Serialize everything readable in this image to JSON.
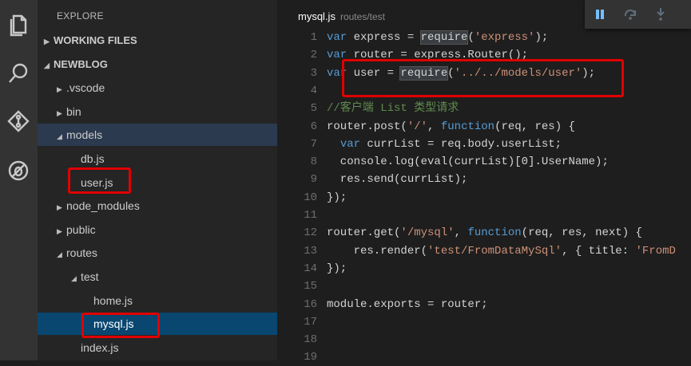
{
  "sidebar": {
    "title": "EXPLORE",
    "items": [
      {
        "label": "WORKING FILES",
        "tw": "▶",
        "indent": 8,
        "section": true
      },
      {
        "label": "NEWBLOG",
        "tw": "◢",
        "indent": 8,
        "section": true
      },
      {
        "label": ".vscode",
        "tw": "▶",
        "indent": 24
      },
      {
        "label": "bin",
        "tw": "▶",
        "indent": 24
      },
      {
        "label": "models",
        "tw": "◢",
        "indent": 24,
        "hl": true
      },
      {
        "label": "db.js",
        "tw": "",
        "indent": 42
      },
      {
        "label": "user.js",
        "tw": "",
        "indent": 42
      },
      {
        "label": "node_modules",
        "tw": "▶",
        "indent": 24
      },
      {
        "label": "public",
        "tw": "▶",
        "indent": 24
      },
      {
        "label": "routes",
        "tw": "◢",
        "indent": 24
      },
      {
        "label": "test",
        "tw": "◢",
        "indent": 42
      },
      {
        "label": "home.js",
        "tw": "",
        "indent": 58
      },
      {
        "label": "mysql.js",
        "tw": "",
        "indent": 58,
        "sel": true
      },
      {
        "label": "index.js",
        "tw": "",
        "indent": 42
      }
    ]
  },
  "editor": {
    "filename": "mysql.js",
    "path": "routes/test",
    "lines": [
      [
        [
          "kw",
          "var "
        ],
        [
          "id",
          "express = "
        ],
        [
          "id",
          "require",
          "hl"
        ],
        [
          "id",
          "("
        ],
        [
          "str",
          "'express'"
        ],
        [
          "id",
          ");"
        ]
      ],
      [
        [
          "kw",
          "var "
        ],
        [
          "id",
          "router = express.Router();"
        ]
      ],
      [
        [
          "kw",
          "var "
        ],
        [
          "id",
          "user = "
        ],
        [
          "id",
          "require",
          "hl"
        ],
        [
          "id",
          "("
        ],
        [
          "str",
          "'../../models/user'"
        ],
        [
          "id",
          ");"
        ]
      ],
      [],
      [
        [
          "cm",
          "//客户端 List 类型请求"
        ]
      ],
      [
        [
          "id",
          "router.post("
        ],
        [
          "str",
          "'/'"
        ],
        [
          "id",
          ", "
        ],
        [
          "kw",
          "function"
        ],
        [
          "id",
          "(req, res) {"
        ]
      ],
      [
        [
          "id",
          "  "
        ],
        [
          "kw",
          "var "
        ],
        [
          "id",
          "currList = req.body.userList;"
        ]
      ],
      [
        [
          "id",
          "  console.log(eval(currList)[0].UserName);"
        ]
      ],
      [
        [
          "id",
          "  res.send(currList);"
        ]
      ],
      [
        [
          "id",
          "});"
        ]
      ],
      [],
      [
        [
          "id",
          "router.get("
        ],
        [
          "str",
          "'/mysql'"
        ],
        [
          "id",
          ", "
        ],
        [
          "kw",
          "function"
        ],
        [
          "id",
          "(req, res, next) {"
        ]
      ],
      [
        [
          "id",
          "    res.render("
        ],
        [
          "str",
          "'test/FromDataMySql'"
        ],
        [
          "id",
          ", { title: "
        ],
        [
          "str",
          "'FromD"
        ]
      ],
      [
        [
          "id",
          "});"
        ]
      ],
      [],
      [
        [
          "id",
          "module.exports = router;"
        ]
      ],
      [],
      [],
      []
    ]
  }
}
